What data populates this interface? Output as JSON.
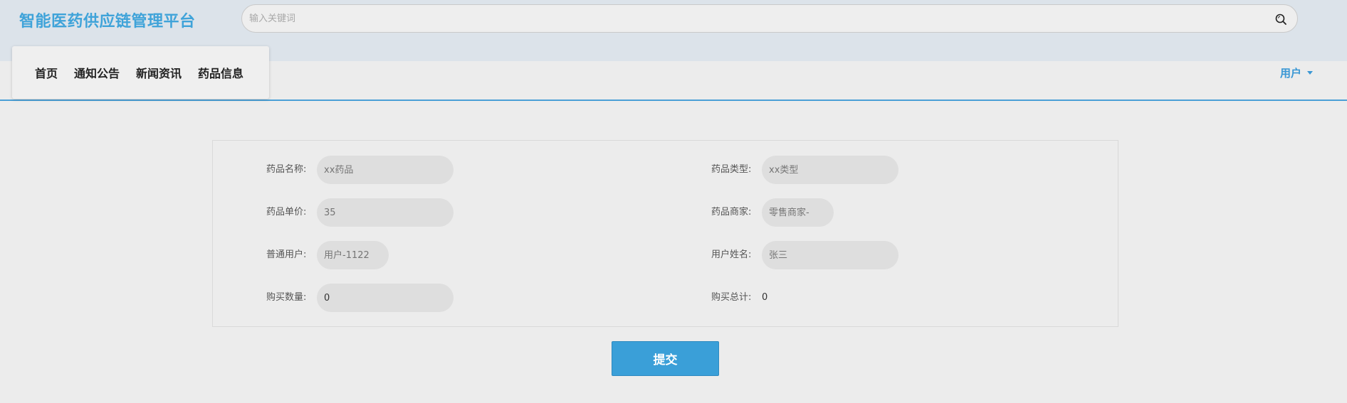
{
  "header": {
    "brand": "智能医药供应链管理平台",
    "search_placeholder": "输入关键词",
    "search_icon": "search-icon"
  },
  "nav": {
    "items": [
      {
        "label": "首页"
      },
      {
        "label": "通知公告"
      },
      {
        "label": "新闻资讯"
      },
      {
        "label": "药品信息"
      }
    ],
    "user_label": "用户"
  },
  "form": {
    "drug_name": {
      "label": "药品名称:",
      "placeholder": "xx药品"
    },
    "drug_type": {
      "label": "药品类型:",
      "placeholder": "xx类型"
    },
    "unit_price": {
      "label": "药品单价:",
      "placeholder": "35"
    },
    "merchant": {
      "label": "药品商家:",
      "placeholder": "零售商家-"
    },
    "user_account": {
      "label": "普通用户:",
      "placeholder": "用户-1122"
    },
    "user_name": {
      "label": "用户姓名:",
      "placeholder": "张三"
    },
    "quantity": {
      "label": "购买数量:",
      "value": "0"
    },
    "total": {
      "label": "购买总计:",
      "value": "0"
    }
  },
  "actions": {
    "submit_label": "提交"
  },
  "colors": {
    "accent": "#3a9fd8",
    "brand": "#3fa3d9",
    "header_bg": "#dce3ea",
    "page_bg": "#ececec"
  }
}
